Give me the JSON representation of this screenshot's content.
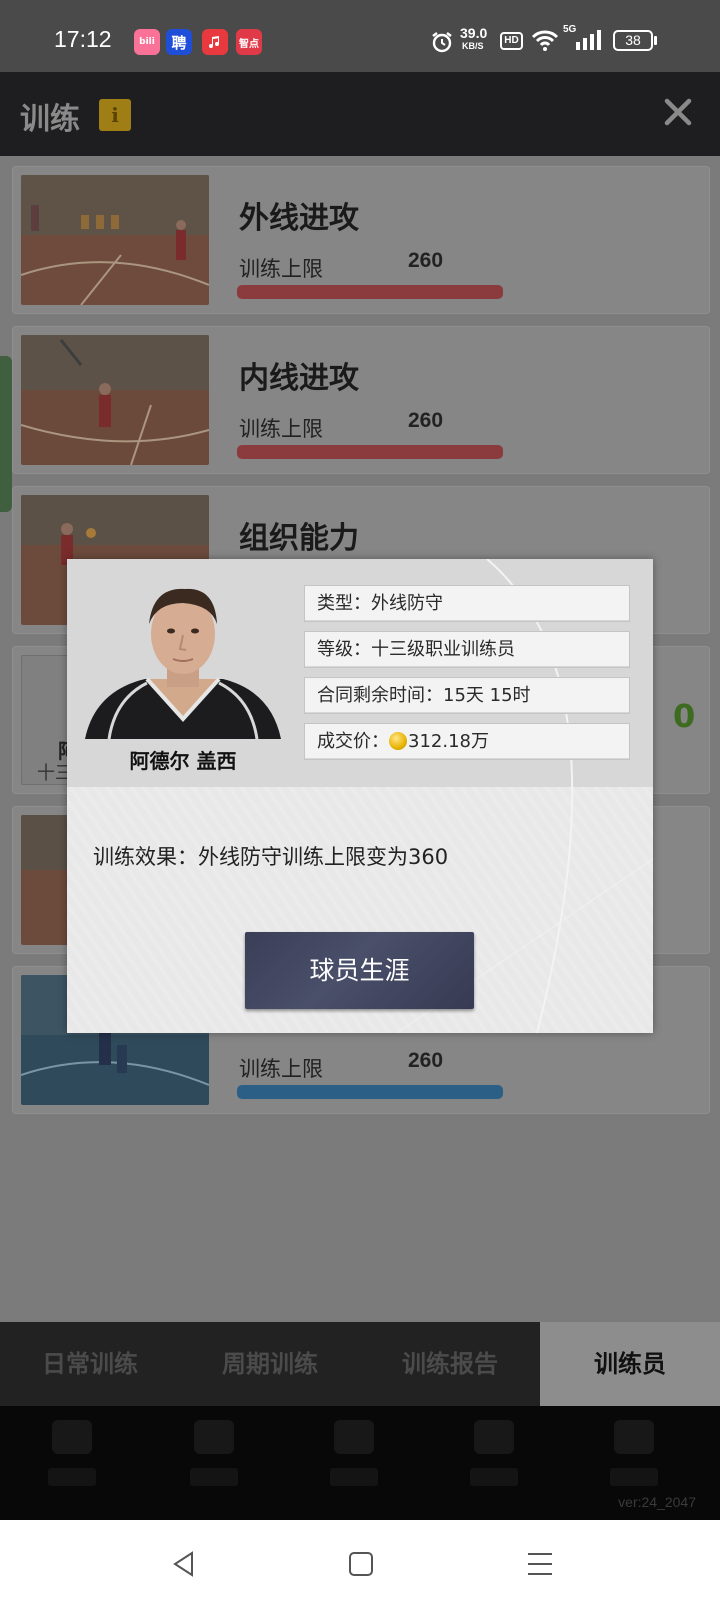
{
  "status_bar": {
    "time": "17:12",
    "apps": [
      "bilibili",
      "聘",
      "music",
      "智点"
    ],
    "net_speed_value": "39.0",
    "net_speed_unit": "KB/S",
    "hd": "HD",
    "signal_label": "5G",
    "battery": "38"
  },
  "header": {
    "title": "训练",
    "info_badge": "i"
  },
  "trainings": [
    {
      "title": "外线进攻",
      "cap_label": "训练上限",
      "cap_value": "260",
      "bar_color": "#8b3a3e"
    },
    {
      "title": "内线进攻",
      "cap_label": "训练上限",
      "cap_value": "260",
      "bar_color": "#8b3a3e"
    },
    {
      "title": "组织能力",
      "cap_label": "",
      "cap_value": "",
      "bar_color": ""
    },
    {
      "title": "",
      "cap_label": "训练上限",
      "cap_value": "260",
      "bar_color": "#2c5f86"
    }
  ],
  "partial_card": {
    "name_fragment": "阿",
    "grade_fragment": "十三",
    "value_fragment": "0"
  },
  "tabs": [
    "日常训练",
    "周期训练",
    "训练报告",
    "训练员"
  ],
  "active_tab": "训练员",
  "version": "ver:24_2047",
  "dialog": {
    "player_name": "阿德尔 盖西",
    "type_line": "类型：外线防守",
    "level_line": "等级：十三级职业训练员",
    "contract_line": "合同剩余时间：15天 15时",
    "price_label": "成交价：",
    "price_value": "312.18万",
    "effect": "训练效果：外线防守训练上限变为360",
    "career_button": "球员生涯"
  },
  "colors": {
    "accent_red_bar": "#8b3a3e",
    "accent_blue_bar": "#2c5f86",
    "partial_green": "#3d6b1f",
    "info_badge": "#a07e16"
  }
}
